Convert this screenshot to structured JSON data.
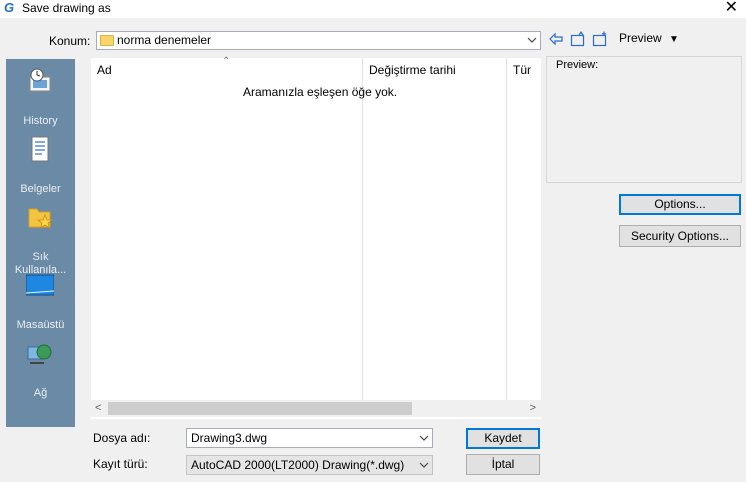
{
  "window": {
    "title": "Save drawing as",
    "app_icon_glyph": "G",
    "close_glyph": "✕"
  },
  "location": {
    "label": "Konum:",
    "path": "norma denemeler"
  },
  "toolbar": {
    "preview_menu_label": "Preview",
    "preview_menu_glyph": "▼"
  },
  "places": [
    {
      "label": "History",
      "icon": "history-icon"
    },
    {
      "label": "Belgeler",
      "icon": "documents-icon"
    },
    {
      "label": "Sık Kullanıla...",
      "icon": "favorites-icon"
    },
    {
      "label": "Masaüstü",
      "icon": "desktop-icon"
    },
    {
      "label": "Ağ",
      "icon": "network-icon"
    }
  ],
  "file_list": {
    "columns": [
      "Ad",
      "Değiştirme tarihi",
      "Tür"
    ],
    "empty_message": "Aramanızla eşleşen öğe yok.",
    "rows": []
  },
  "preview_pane": {
    "label": "Preview:"
  },
  "buttons": {
    "options": "Options...",
    "security_options": "Security Options...",
    "save": "Kaydet",
    "cancel": "İptal"
  },
  "fields": {
    "filename_label": "Dosya adı:",
    "filename_value": "Drawing3.dwg",
    "filetype_label": "Kayıt türü:",
    "filetype_value": "AutoCAD 2000(LT2000) Drawing(*.dwg)"
  },
  "colors": {
    "places_bg": "#6b8aa5",
    "focus_border": "#0078d7",
    "folder": "#f7d56b"
  }
}
